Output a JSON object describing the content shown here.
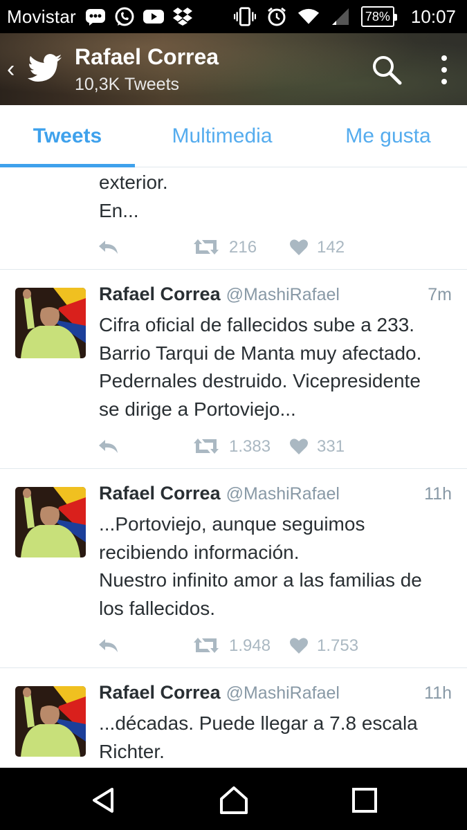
{
  "statusbar": {
    "carrier": "Movistar",
    "battery": "78%",
    "time": "10:07",
    "icons": [
      "bbm-icon",
      "whatsapp-icon",
      "youtube-icon",
      "dropbox-icon",
      "vibrate-icon",
      "alarm-icon",
      "wifi-icon",
      "signal-icon",
      "battery-icon"
    ]
  },
  "header": {
    "title": "Rafael Correa",
    "subtitle": "10,3K Tweets"
  },
  "tabs": [
    {
      "label": "Tweets",
      "active": true
    },
    {
      "label": "Multimedia",
      "active": false
    },
    {
      "label": "Me gusta",
      "active": false
    }
  ],
  "tweets": [
    {
      "name": "",
      "handle": "",
      "time": "",
      "text": "exterior.\nEn...",
      "retweets": "216",
      "likes": "142",
      "partial": true
    },
    {
      "name": "Rafael Correa",
      "handle": "@MashiRafael",
      "time": "7m",
      "text": "Cifra oficial de fallecidos sube a 233.\nBarrio Tarqui de Manta muy afectado.\nPedernales destruido. Vicepresidente\nse dirige a Portoviejo...",
      "retweets": "1.383",
      "likes": "331"
    },
    {
      "name": "Rafael Correa",
      "handle": "@MashiRafael",
      "time": "11h",
      "text": "...Portoviejo, aunque seguimos\nrecibiendo información.\nNuestro infinito amor a las familias de\nlos fallecidos.",
      "retweets": "1.948",
      "likes": "1.753"
    },
    {
      "name": "Rafael Correa",
      "handle": "@MashiRafael",
      "time": "11h",
      "text": "...décadas. Puede llegar a 7.8 escala\nRichter.",
      "retweets": "",
      "likes": ""
    }
  ],
  "colors": {
    "accent": "#3ea1ec",
    "text": "#292f33",
    "muted": "#8899a6",
    "action": "#aab8c2"
  }
}
